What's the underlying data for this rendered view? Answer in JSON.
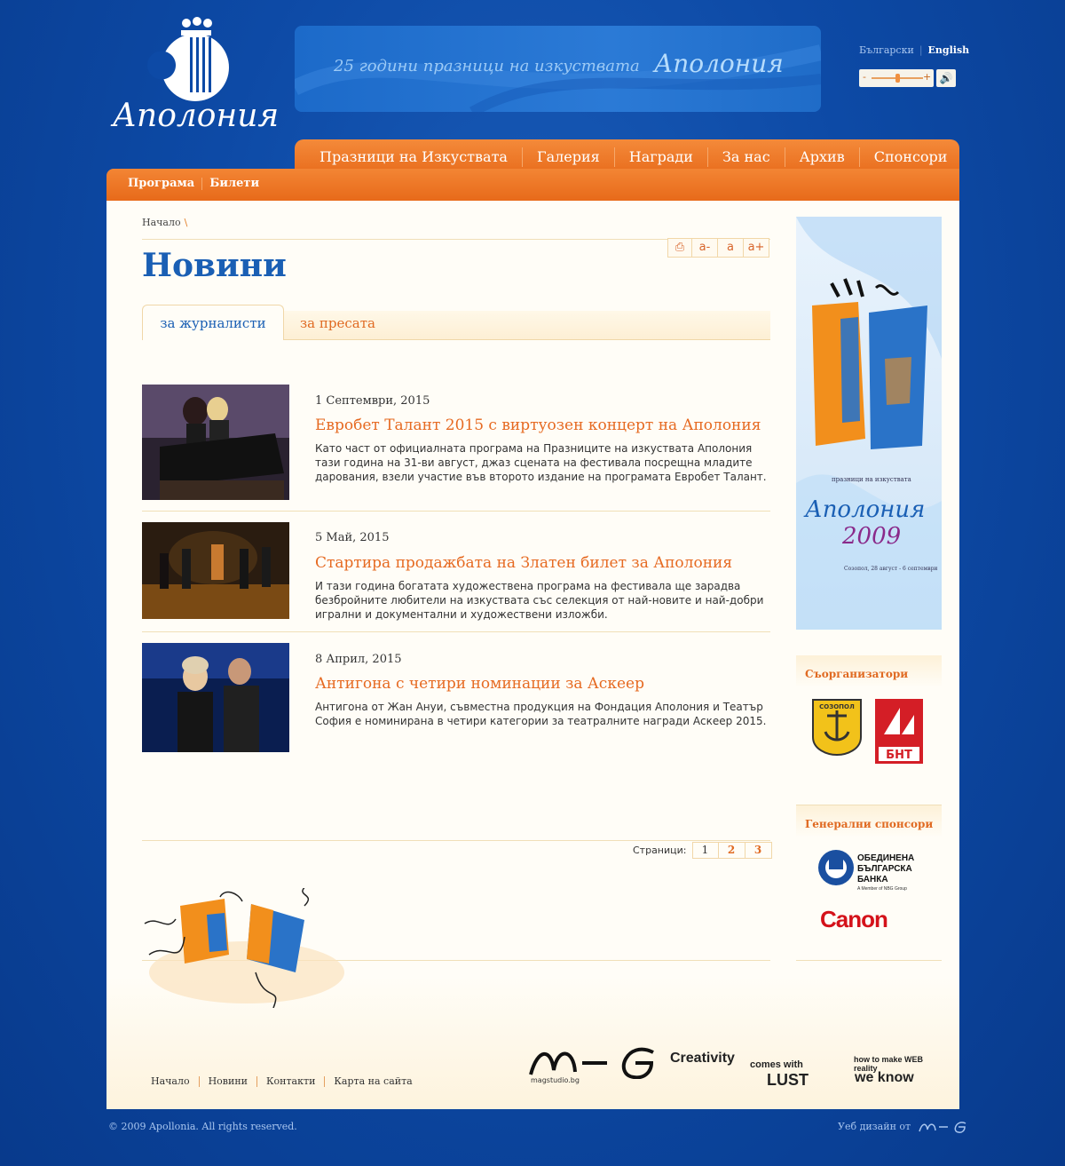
{
  "header": {
    "logo_text": "Аполония",
    "banner_text": "25 години празници на изкуствата",
    "banner_brand": "Аполония",
    "lang_bg": "Български",
    "lang_en": "English",
    "volume_level": 0.5
  },
  "mainnav": {
    "items": [
      "Празници на Изкуствата",
      "Галерия",
      "Награди",
      "За нас",
      "Архив",
      "Спонсори"
    ]
  },
  "subnav": {
    "items": [
      "Програма",
      "Билети"
    ]
  },
  "breadcrumb": {
    "home": "Начало",
    "sep": "\\"
  },
  "tools": {
    "print": "⎙",
    "smaller": "a-",
    "normal": "a",
    "larger": "a+"
  },
  "page": {
    "title": "Новини"
  },
  "tabs": {
    "active": "за журналисти",
    "other": "за пресата"
  },
  "news": [
    {
      "date": "1 Септември, 2015",
      "title": "Евробет Талант 2015 с виртуозен концерт на Аполония",
      "desc": "Като част от официалната програма на Празниците на изкуствата Аполония тази година на 31-ви август, джаз сцената на фестивала посрещна младите дарования, взели участие във второто издание на програмата Евробет Талант."
    },
    {
      "date": "5 Май, 2015",
      "title": "Стартира продажбата на Златен билет за Аполония",
      "desc": "И тази година богатата художествена програма на фестивала ще зарадва безбройните любители на изкуствата със селекция от най-новите и най-добри игрални и документални и художествени изложби."
    },
    {
      "date": "8 Април, 2015",
      "title": "Антигона с четири номинации за Аскеер",
      "desc": "Антигона от Жан Ануи, съвместна продукция на Фондация Аполония и Театър София е номинирана в четири категории за театралните награди Аскеер 2015."
    }
  ],
  "pager": {
    "label": "Страници:",
    "pages": [
      "1",
      "2",
      "3"
    ]
  },
  "sidebar": {
    "banner_brand": "Аполония",
    "banner_year": "2009",
    "banner_small": "празници на изкуствата",
    "banner_dates": "Созопол, 28 август - 6 септември",
    "coorganizers_title": "Съорганизатори",
    "bnt_label": "БНТ",
    "sozopol_label": "СОЗОПОЛ",
    "sponsors_title": "Генерални спонсори",
    "ubb_line1": "ОБЕДИНЕНА",
    "ubb_line2": "БЪЛГАРСКА",
    "ubb_line3": "БАНКА",
    "ubb_member": "A Member of NBG Group",
    "canon": "Canon"
  },
  "footer": {
    "nav": [
      "Начало",
      "Новини",
      "Контакти",
      "Карта на сайта"
    ],
    "mfg_sub": "magstudio.bg",
    "slogan_creativity": "Creativity",
    "slogan_comes_with": "comes with",
    "slogan_lust": "LUST",
    "slogan_how": "how to make WEB reality",
    "slogan_we_know": "we know",
    "copyright": "© 2009 Apollonia. All rights reserved.",
    "webdesign": "Уеб дизайн  от"
  },
  "colors": {
    "background": "#0d4aa6",
    "accent_orange": "#e86c1c",
    "title_blue": "#1a5fb4",
    "link_orange": "#e66a22"
  }
}
